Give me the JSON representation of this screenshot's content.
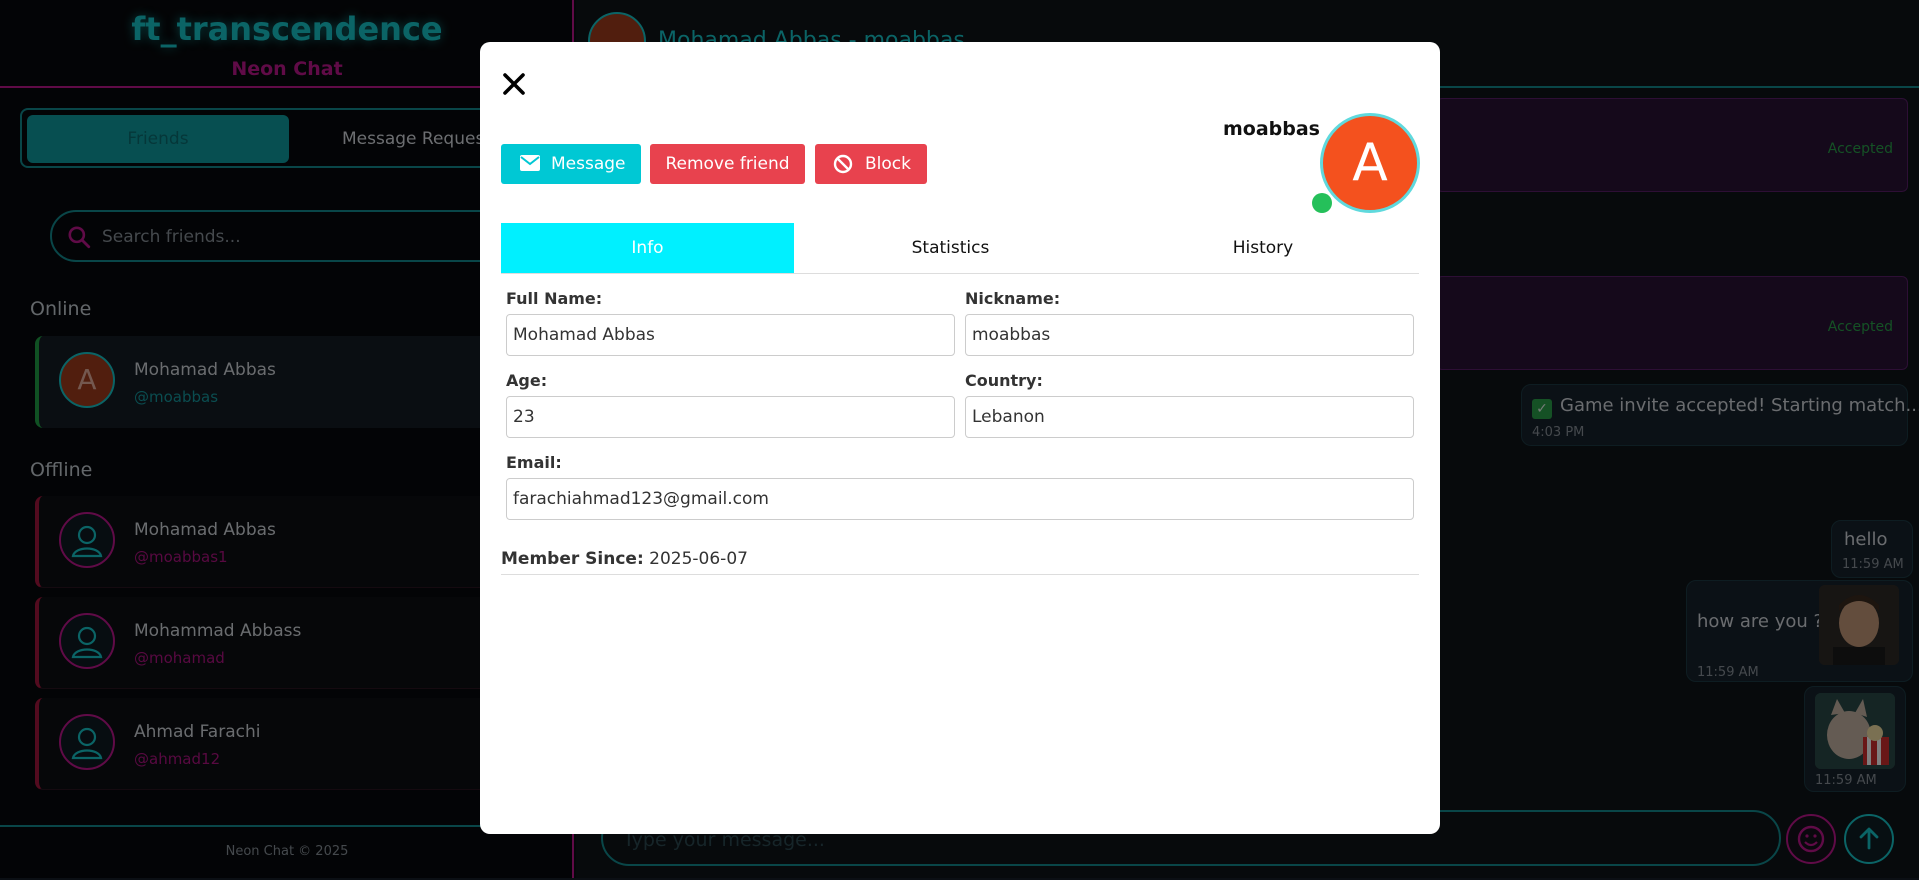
{
  "sidebar": {
    "brand_title": "ft_transcendence",
    "brand_subtitle": "Neon Chat",
    "tabs": {
      "friends": "Friends",
      "requests": "Message Requests"
    },
    "search_placeholder": "Search friends...",
    "online_label": "Online",
    "offline_label": "Offline",
    "online_friends": [
      {
        "initial": "A",
        "name": "Mohamad Abbas",
        "handle": "@moabbas"
      }
    ],
    "offline_friends": [
      {
        "name": "Mohamad Abbas",
        "handle": "@moabbas1"
      },
      {
        "name": "Mohammad Abbass",
        "handle": "@mohamad"
      },
      {
        "name": "Ahmad Farachi",
        "handle": "@ahmad12"
      }
    ],
    "footer": "Neon Chat © 2025"
  },
  "chat": {
    "header_initial": "A",
    "header_name": "Mohamad Abbas - moabbas",
    "accepted_label": "Accepted",
    "system_message": "Game invite accepted! Starting match...",
    "system_time": "4:03 PM",
    "messages": [
      {
        "text": "hello",
        "time": "11:59 AM"
      },
      {
        "text": "how are you ?",
        "time": "11:59 AM"
      },
      {
        "text": "",
        "time": "11:59 AM"
      }
    ],
    "input_placeholder": "Type your message..."
  },
  "modal": {
    "username": "moabbas",
    "avatar_initial": "A",
    "buttons": {
      "message": "Message",
      "remove": "Remove friend",
      "block": "Block"
    },
    "tabs": [
      "Info",
      "Statistics",
      "History"
    ],
    "fields": {
      "full_name": {
        "label": "Full Name:",
        "value": "Mohamad Abbas"
      },
      "nickname": {
        "label": "Nickname:",
        "value": "moabbas"
      },
      "age": {
        "label": "Age:",
        "value": "23"
      },
      "country": {
        "label": "Country:",
        "value": "Lebanon"
      },
      "email": {
        "label": "Email:",
        "value": "farachiahmad123@gmail.com"
      }
    },
    "member_since_label": "Member Since:",
    "member_since_value": "2025-06-07"
  },
  "colors": {
    "neon_cyan": "#16c8cc",
    "neon_magenta": "#c0168f",
    "message_button": "#00c8d4",
    "danger_button": "#e8424e",
    "active_tab": "#00f0ff",
    "avatar_orange": "#f4511e",
    "online_green": "#25c05a"
  }
}
